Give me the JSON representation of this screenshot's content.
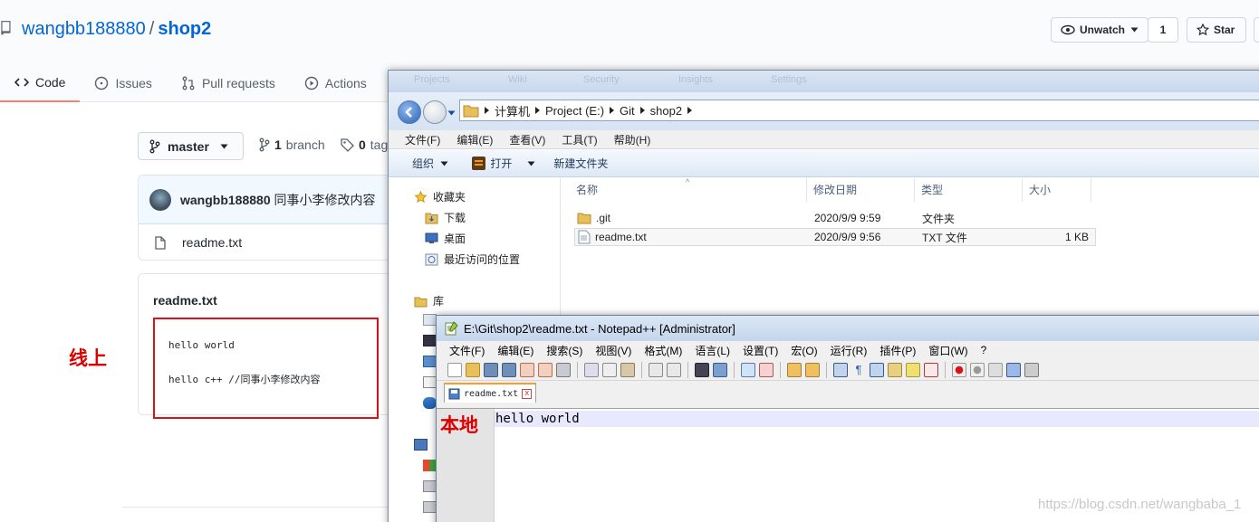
{
  "github": {
    "owner": "wangbb188880",
    "separator": "/",
    "repo": "shop2",
    "watch_label": "Unwatch",
    "watch_count": "1",
    "star_label": "Star",
    "tabs": [
      {
        "label": "Code",
        "icon": "code-icon"
      },
      {
        "label": "Issues",
        "icon": "issue-icon"
      },
      {
        "label": "Pull requests",
        "icon": "pull-request-icon"
      },
      {
        "label": "Actions",
        "icon": "play-icon"
      }
    ],
    "branch_label": "master",
    "branch_count": "1",
    "branch_word": "branch",
    "tags_count": "0",
    "tags_word": "tags",
    "commit": {
      "author": "wangbb188880",
      "message": "同事小李修改内容"
    },
    "file_name": "readme.txt",
    "readme": {
      "title": "readme.txt",
      "lines": [
        "hello world",
        "hello c++ //同事小李修改内容"
      ]
    },
    "annotation_online": "线上"
  },
  "explorer": {
    "ghost_tabs": [
      "Projects",
      "Wiki",
      "Security",
      "Insights",
      "Settings"
    ],
    "breadcrumb": [
      "计算机",
      "Project (E:)",
      "Git",
      "shop2"
    ],
    "menu": [
      "文件(F)",
      "编辑(E)",
      "查看(V)",
      "工具(T)",
      "帮助(H)"
    ],
    "toolbar": {
      "organize": "组织",
      "open": "打开",
      "new_folder": "新建文件夹"
    },
    "nav": {
      "favorites": "收藏夹",
      "downloads": "下载",
      "desktop": "桌面",
      "recent": "最近访问的位置",
      "libraries": "库"
    },
    "columns": {
      "name": "名称",
      "modified": "修改日期",
      "type": "类型",
      "size": "大小"
    },
    "files": [
      {
        "name": ".git",
        "modified": "2020/9/9 9:59",
        "type": "文件夹",
        "size": ""
      },
      {
        "name": "readme.txt",
        "modified": "2020/9/9 9:56",
        "type": "TXT 文件",
        "size": "1 KB"
      }
    ]
  },
  "notepad": {
    "title": "E:\\Git\\shop2\\readme.txt - Notepad++ [Administrator]",
    "menu": [
      "文件(F)",
      "编辑(E)",
      "搜索(S)",
      "视图(V)",
      "格式(M)",
      "语言(L)",
      "设置(T)",
      "宏(O)",
      "运行(R)",
      "插件(P)",
      "窗口(W)",
      "?"
    ],
    "tab_label": "readme.txt",
    "tab_close": "x",
    "content": "hello world",
    "annotation_local": "本地"
  },
  "watermark": "https://blog.csdn.net/wangbaba_1",
  "colors": {
    "link": "#0366d6",
    "annotation": "#dd0000",
    "tab_active": "#f9826c"
  }
}
